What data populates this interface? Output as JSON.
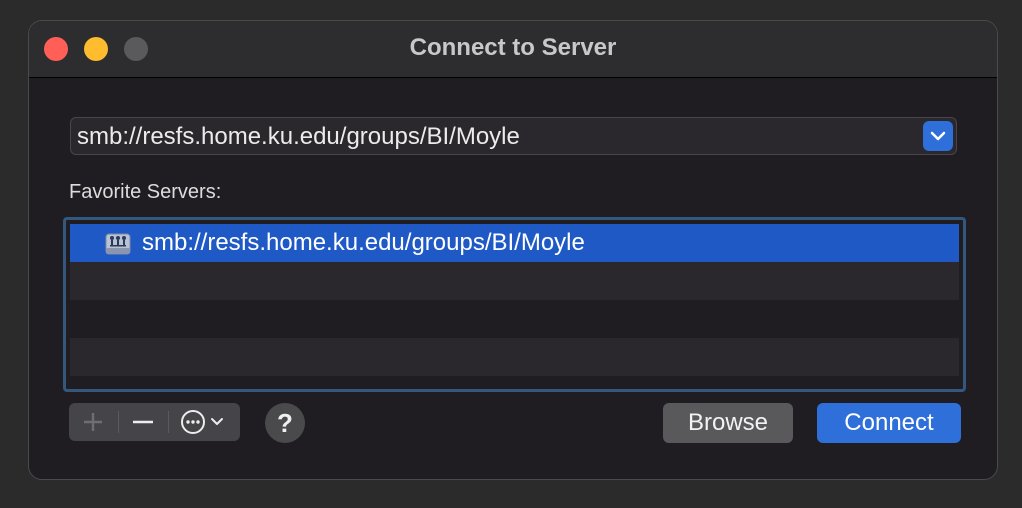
{
  "window": {
    "title": "Connect to Server"
  },
  "address": {
    "value": "smb://resfs.home.ku.edu/groups/BI/Moyle",
    "dropdown_icon": "chevron-down-icon"
  },
  "favorites": {
    "label": "Favorite Servers:",
    "items": [
      {
        "label": "smb://resfs.home.ku.edu/groups/BI/Moyle",
        "icon": "network-server-icon",
        "selected": true
      }
    ]
  },
  "toolbar": {
    "add_icon": "plus-icon",
    "remove_icon": "minus-icon",
    "more_icon": "ellipsis-circle-icon",
    "help_label": "?",
    "browse_label": "Browse",
    "connect_label": "Connect"
  },
  "colors": {
    "accent": "#2f6fd9",
    "selection": "#1f59c5",
    "close": "#ff5f57",
    "minimize": "#febc2e"
  }
}
